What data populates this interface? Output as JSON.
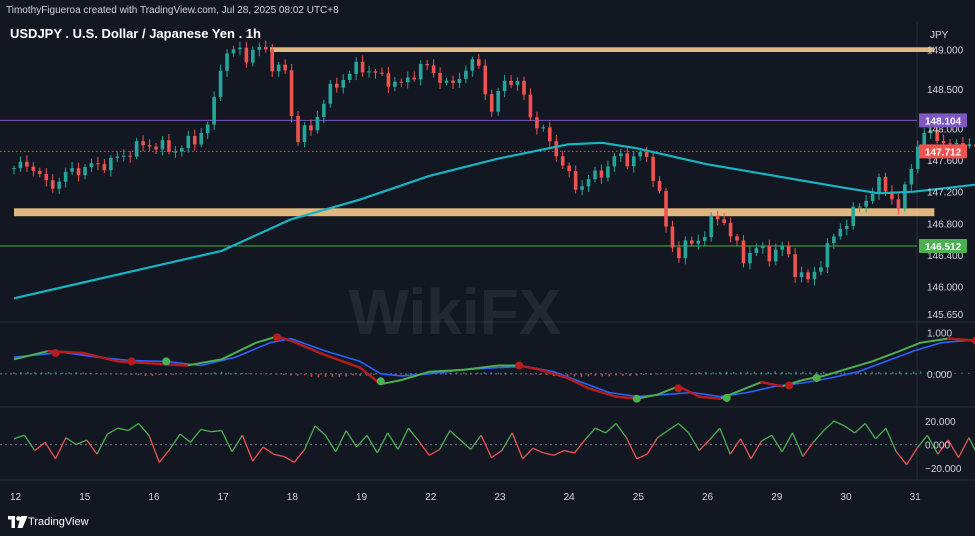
{
  "header": {
    "credit": "TimothyFigueroa created with TradingView.com, Jul 28, 2025 08:02 UTC+8"
  },
  "footer": {
    "brand": "TradingView"
  },
  "watermark": "WikiFX",
  "colors": {
    "up": "#26a69a",
    "down": "#ef5350",
    "ma": "#16b5c4",
    "zone": "#f7c88c",
    "purple_line": "#7e57c2",
    "green_line": "#4caf50",
    "red_dot_line": "#ef5350",
    "macd": "#2962ff",
    "signal_fast": "#4caf50",
    "signal_slow": "#b71c1c"
  },
  "chart_data": [
    {
      "type": "candlestick",
      "title": "USDJPY . U.S. Dollar / Japanese Yen . 1h",
      "currency": "JPY",
      "ylim": [
        145.55,
        149.35
      ],
      "x_ticks": [
        "12",
        "15",
        "16",
        "17",
        "18",
        "19",
        "22",
        "23",
        "24",
        "25",
        "26",
        "29",
        "30",
        "31"
      ],
      "y_ticks": [
        "149.000",
        "148.500",
        "148.000",
        "147.600",
        "147.200",
        "146.800",
        "146.400",
        "146.000",
        "145.650"
      ],
      "price_labels": [
        {
          "value": 148.104,
          "label": "148.104",
          "color": "#7e57c2",
          "line": "solid"
        },
        {
          "value": 147.712,
          "label": "147.712",
          "color": "#ef5350",
          "line": "dotted"
        },
        {
          "value": 146.512,
          "label": "146.512",
          "color": "#4caf50",
          "line": "solid"
        }
      ],
      "zones": [
        {
          "from": 148.97,
          "to": 149.03,
          "x_start_day": 3.7,
          "x_end_day": 13.3
        },
        {
          "from": 146.89,
          "to": 146.99,
          "x_start_day": 0.0,
          "x_end_day": 13.3
        }
      ],
      "close_path": [
        [
          0.0,
          147.5
        ],
        [
          0.25,
          147.55
        ],
        [
          0.5,
          147.25
        ],
        [
          0.8,
          147.45
        ],
        [
          1.0,
          147.5
        ],
        [
          1.3,
          147.55
        ],
        [
          1.5,
          147.62
        ],
        [
          1.8,
          147.78
        ],
        [
          2.0,
          147.8
        ],
        [
          2.3,
          147.72
        ],
        [
          2.6,
          147.85
        ],
        [
          2.85,
          148.1
        ],
        [
          3.0,
          148.9
        ],
        [
          3.2,
          149.0
        ],
        [
          3.4,
          148.92
        ],
        [
          3.6,
          149.05
        ],
        [
          3.8,
          148.7
        ],
        [
          3.9,
          148.85
        ],
        [
          4.0,
          148.2
        ],
        [
          4.1,
          147.9
        ],
        [
          4.3,
          148.0
        ],
        [
          4.5,
          148.4
        ],
        [
          4.7,
          148.6
        ],
        [
          5.0,
          148.8
        ],
        [
          5.3,
          148.65
        ],
        [
          5.6,
          148.55
        ],
        [
          5.9,
          148.8
        ],
        [
          6.1,
          148.7
        ],
        [
          6.3,
          148.5
        ],
        [
          6.5,
          148.75
        ],
        [
          6.7,
          148.85
        ],
        [
          6.9,
          148.2
        ],
        [
          7.1,
          148.65
        ],
        [
          7.3,
          148.55
        ],
        [
          7.5,
          148.1
        ],
        [
          7.7,
          147.9
        ],
        [
          7.9,
          147.6
        ],
        [
          8.1,
          147.25
        ],
        [
          8.3,
          147.35
        ],
        [
          8.5,
          147.45
        ],
        [
          8.7,
          147.65
        ],
        [
          8.9,
          147.6
        ],
        [
          9.1,
          147.7
        ],
        [
          9.3,
          147.3
        ],
        [
          9.4,
          146.8
        ],
        [
          9.55,
          146.4
        ],
        [
          9.7,
          146.5
        ],
        [
          9.9,
          146.6
        ],
        [
          10.0,
          146.7
        ],
        [
          10.15,
          146.9
        ],
        [
          10.3,
          146.8
        ],
        [
          10.4,
          146.55
        ],
        [
          10.55,
          146.35
        ],
        [
          10.7,
          146.5
        ],
        [
          10.9,
          146.4
        ],
        [
          11.1,
          146.5
        ],
        [
          11.3,
          146.2
        ],
        [
          11.5,
          146.05
        ],
        [
          11.7,
          146.4
        ],
        [
          11.9,
          146.7
        ],
        [
          12.1,
          146.9
        ],
        [
          12.3,
          147.1
        ],
        [
          12.5,
          147.3
        ],
        [
          12.65,
          147.2
        ],
        [
          12.8,
          146.95
        ],
        [
          12.95,
          147.5
        ],
        [
          13.1,
          147.9
        ],
        [
          13.3,
          147.95
        ],
        [
          13.5,
          147.75
        ],
        [
          13.7,
          147.85
        ],
        [
          13.9,
          147.72
        ]
      ],
      "ma_path": [
        [
          0.0,
          145.85
        ],
        [
          1.0,
          146.05
        ],
        [
          2.0,
          146.25
        ],
        [
          3.0,
          146.45
        ],
        [
          4.0,
          146.85
        ],
        [
          5.0,
          147.1
        ],
        [
          6.0,
          147.4
        ],
        [
          7.0,
          147.62
        ],
        [
          8.0,
          147.8
        ],
        [
          8.5,
          147.82
        ],
        [
          9.0,
          147.75
        ],
        [
          10.0,
          147.55
        ],
        [
          11.0,
          147.4
        ],
        [
          12.0,
          147.25
        ],
        [
          12.5,
          147.18
        ],
        [
          13.0,
          147.2
        ],
        [
          13.5,
          147.25
        ],
        [
          14.0,
          147.3
        ]
      ]
    },
    {
      "type": "line",
      "name": "macd",
      "ylim": [
        -0.8,
        1.25
      ],
      "y_ticks": [
        "1.000",
        "0.000"
      ],
      "fast_path": [
        [
          0.0,
          0.35
        ],
        [
          0.5,
          0.55
        ],
        [
          1.0,
          0.5
        ],
        [
          1.5,
          0.3
        ],
        [
          2.0,
          0.25
        ],
        [
          2.5,
          0.2
        ],
        [
          3.0,
          0.35
        ],
        [
          3.5,
          0.75
        ],
        [
          3.8,
          0.9
        ],
        [
          4.0,
          0.8
        ],
        [
          4.5,
          0.45
        ],
        [
          5.0,
          0.15
        ],
        [
          5.3,
          -0.25
        ],
        [
          5.6,
          -0.15
        ],
        [
          6.0,
          0.05
        ],
        [
          6.5,
          0.1
        ],
        [
          7.0,
          0.2
        ],
        [
          7.3,
          0.2
        ],
        [
          7.6,
          0.1
        ],
        [
          8.0,
          -0.1
        ],
        [
          8.3,
          -0.35
        ],
        [
          8.7,
          -0.55
        ],
        [
          9.0,
          -0.6
        ],
        [
          9.3,
          -0.5
        ],
        [
          9.6,
          -0.3
        ],
        [
          9.9,
          -0.55
        ],
        [
          10.2,
          -0.6
        ],
        [
          10.5,
          -0.4
        ],
        [
          10.8,
          -0.2
        ],
        [
          11.1,
          -0.3
        ],
        [
          11.4,
          -0.15
        ],
        [
          11.7,
          -0.05
        ],
        [
          12.0,
          0.1
        ],
        [
          12.4,
          0.3
        ],
        [
          12.8,
          0.55
        ],
        [
          13.1,
          0.75
        ],
        [
          13.5,
          0.85
        ],
        [
          13.9,
          0.8
        ]
      ],
      "slow_path": [
        [
          0.0,
          0.4
        ],
        [
          0.7,
          0.52
        ],
        [
          1.2,
          0.4
        ],
        [
          1.7,
          0.32
        ],
        [
          2.2,
          0.3
        ],
        [
          2.7,
          0.2
        ],
        [
          3.2,
          0.4
        ],
        [
          3.7,
          0.75
        ],
        [
          4.0,
          0.85
        ],
        [
          4.5,
          0.55
        ],
        [
          5.0,
          0.3
        ],
        [
          5.3,
          0.0
        ],
        [
          5.6,
          -0.05
        ],
        [
          6.0,
          0.0
        ],
        [
          6.5,
          0.1
        ],
        [
          7.0,
          0.15
        ],
        [
          7.4,
          0.18
        ],
        [
          7.8,
          0.05
        ],
        [
          8.2,
          -0.2
        ],
        [
          8.6,
          -0.45
        ],
        [
          9.0,
          -0.55
        ],
        [
          9.4,
          -0.5
        ],
        [
          9.8,
          -0.45
        ],
        [
          10.2,
          -0.55
        ],
        [
          10.6,
          -0.45
        ],
        [
          11.0,
          -0.3
        ],
        [
          11.4,
          -0.22
        ],
        [
          11.8,
          -0.1
        ],
        [
          12.2,
          0.05
        ],
        [
          12.6,
          0.3
        ],
        [
          13.0,
          0.55
        ],
        [
          13.4,
          0.75
        ],
        [
          13.9,
          0.82
        ]
      ],
      "dots": [
        {
          "x": 0.6,
          "y": 0.5,
          "color": "#b71c1c"
        },
        {
          "x": 1.7,
          "y": 0.3,
          "color": "#b71c1c"
        },
        {
          "x": 2.2,
          "y": 0.3,
          "color": "#4caf50"
        },
        {
          "x": 3.8,
          "y": 0.88,
          "color": "#b71c1c"
        },
        {
          "x": 5.3,
          "y": -0.18,
          "color": "#4caf50"
        },
        {
          "x": 7.3,
          "y": 0.2,
          "color": "#b71c1c"
        },
        {
          "x": 9.0,
          "y": -0.6,
          "color": "#4caf50"
        },
        {
          "x": 9.6,
          "y": -0.35,
          "color": "#b71c1c"
        },
        {
          "x": 10.3,
          "y": -0.58,
          "color": "#4caf50"
        },
        {
          "x": 11.2,
          "y": -0.28,
          "color": "#b71c1c"
        },
        {
          "x": 11.6,
          "y": -0.1,
          "color": "#4caf50"
        },
        {
          "x": 13.9,
          "y": 0.8,
          "color": "#b71c1c"
        }
      ],
      "hist_path": [
        [
          0.0,
          0.05
        ],
        [
          1.0,
          0.04
        ],
        [
          2.0,
          -0.06
        ],
        [
          3.0,
          0.05
        ],
        [
          4.0,
          -0.04
        ],
        [
          4.5,
          -0.1
        ],
        [
          5.0,
          -0.05
        ],
        [
          6.0,
          0.03
        ],
        [
          7.0,
          0.04
        ],
        [
          8.0,
          -0.08
        ],
        [
          9.0,
          -0.05
        ],
        [
          10.0,
          0.05
        ],
        [
          11.0,
          0.06
        ],
        [
          12.0,
          0.04
        ],
        [
          13.0,
          0.06
        ],
        [
          13.9,
          0.02
        ]
      ]
    },
    {
      "type": "line",
      "name": "oscillator",
      "ylim": [
        -30,
        32
      ],
      "y_ticks": [
        "20.000",
        "0.000",
        "−20.000"
      ],
      "path": [
        [
          0.0,
          5
        ],
        [
          0.15,
          8
        ],
        [
          0.3,
          -5
        ],
        [
          0.45,
          2
        ],
        [
          0.6,
          -12
        ],
        [
          0.75,
          6
        ],
        [
          0.9,
          0
        ],
        [
          1.05,
          4
        ],
        [
          1.2,
          -8
        ],
        [
          1.35,
          9
        ],
        [
          1.5,
          14
        ],
        [
          1.65,
          12
        ],
        [
          1.8,
          18
        ],
        [
          1.95,
          8
        ],
        [
          2.1,
          -15
        ],
        [
          2.25,
          -4
        ],
        [
          2.4,
          9
        ],
        [
          2.55,
          2
        ],
        [
          2.7,
          13
        ],
        [
          2.85,
          11
        ],
        [
          3.0,
          12
        ],
        [
          3.15,
          -6
        ],
        [
          3.3,
          8
        ],
        [
          3.45,
          -14
        ],
        [
          3.6,
          -2
        ],
        [
          3.75,
          -8
        ],
        [
          3.9,
          -10
        ],
        [
          4.05,
          -15
        ],
        [
          4.2,
          -4
        ],
        [
          4.35,
          16
        ],
        [
          4.5,
          8
        ],
        [
          4.65,
          -6
        ],
        [
          4.8,
          12
        ],
        [
          4.95,
          -2
        ],
        [
          5.1,
          8
        ],
        [
          5.25,
          -7
        ],
        [
          5.4,
          10
        ],
        [
          5.55,
          -4
        ],
        [
          5.7,
          14
        ],
        [
          5.85,
          3
        ],
        [
          6.0,
          -9
        ],
        [
          6.15,
          -4
        ],
        [
          6.3,
          12
        ],
        [
          6.45,
          4
        ],
        [
          6.6,
          -4
        ],
        [
          6.75,
          8
        ],
        [
          6.9,
          -11
        ],
        [
          7.05,
          -5
        ],
        [
          7.2,
          10
        ],
        [
          7.35,
          -12
        ],
        [
          7.5,
          -3
        ],
        [
          7.65,
          -7
        ],
        [
          7.8,
          -9
        ],
        [
          7.95,
          -5
        ],
        [
          8.1,
          -7
        ],
        [
          8.25,
          4
        ],
        [
          8.4,
          14
        ],
        [
          8.55,
          10
        ],
        [
          8.7,
          18
        ],
        [
          8.85,
          6
        ],
        [
          9.0,
          -12
        ],
        [
          9.15,
          -8
        ],
        [
          9.3,
          6
        ],
        [
          9.45,
          12
        ],
        [
          9.6,
          18
        ],
        [
          9.75,
          10
        ],
        [
          9.9,
          -5
        ],
        [
          10.05,
          4
        ],
        [
          10.2,
          14
        ],
        [
          10.35,
          -8
        ],
        [
          10.5,
          5
        ],
        [
          10.65,
          -12
        ],
        [
          10.8,
          3
        ],
        [
          10.95,
          8
        ],
        [
          11.1,
          -6
        ],
        [
          11.25,
          10
        ],
        [
          11.4,
          -10
        ],
        [
          11.55,
          2
        ],
        [
          11.7,
          12
        ],
        [
          11.85,
          20
        ],
        [
          12.0,
          16
        ],
        [
          12.15,
          10
        ],
        [
          12.3,
          18
        ],
        [
          12.45,
          5
        ],
        [
          12.6,
          14
        ],
        [
          12.75,
          -6
        ],
        [
          12.9,
          -17
        ],
        [
          13.05,
          -3
        ],
        [
          13.2,
          8
        ],
        [
          13.35,
          -8
        ],
        [
          13.5,
          4
        ],
        [
          13.65,
          -11
        ],
        [
          13.8,
          6
        ],
        [
          13.9,
          -6
        ]
      ]
    }
  ]
}
